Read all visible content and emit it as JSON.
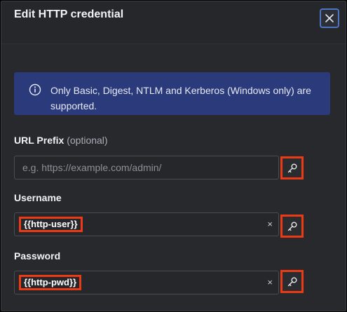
{
  "dialog": {
    "title": "Edit HTTP credential",
    "close_icon": "close-icon"
  },
  "banner": {
    "icon": "info-icon",
    "text": "Only Basic, Digest, NTLM and Kerberos (Windows only) are supported."
  },
  "url_prefix": {
    "label": "URL Prefix",
    "optional": "(optional)",
    "placeholder": "e.g. https://example.com/admin/",
    "key_icon": "key-icon"
  },
  "username": {
    "label": "Username",
    "value": "{{http-user}}",
    "clear": "×",
    "key_icon": "key-icon"
  },
  "password": {
    "label": "Password",
    "value": "{{http-pwd}}",
    "clear": "×",
    "key_icon": "key-icon"
  },
  "colors": {
    "dialog_bg": "#25272b",
    "banner_bg": "#2a3a7a",
    "highlight": "#ea3a16",
    "focus_ring": "#4f74c2"
  }
}
